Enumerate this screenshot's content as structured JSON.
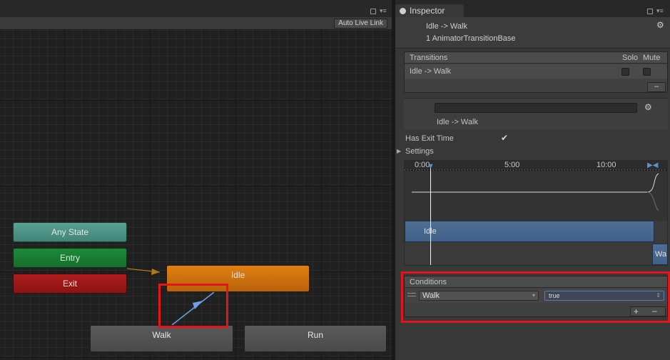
{
  "graph": {
    "toolbar": {
      "auto_live_link": "Auto Live Link"
    },
    "nodes": {
      "any_state": "Any State",
      "entry": "Entry",
      "exit": "Exit",
      "idle": "Idle",
      "walk": "Walk",
      "run": "Run"
    }
  },
  "inspector": {
    "tab_label": "Inspector",
    "header": {
      "title": "Idle -> Walk",
      "subtitle": "1 AnimatorTransitionBase"
    },
    "transitions": {
      "heading": "Transitions",
      "col_solo": "Solo",
      "col_mute": "Mute",
      "rows": [
        {
          "label": "Idle -> Walk",
          "solo": false,
          "mute": false
        }
      ],
      "remove_label": "–"
    },
    "name_section": {
      "name_value": "",
      "label": "Idle -> Walk"
    },
    "has_exit_time": {
      "label": "Has Exit Time",
      "checked": true
    },
    "settings": {
      "label": "Settings"
    },
    "timeline": {
      "ticks": [
        "0:00",
        "5:00",
        "10:00"
      ],
      "idle_clip": "Idle",
      "walk_clip": "Wa"
    },
    "conditions": {
      "heading": "Conditions",
      "parameter": "Walk",
      "value": "true",
      "add_label": "+",
      "remove_label": "–"
    }
  },
  "colors": {
    "highlight": "#e3151c",
    "idle_state": "#e08014",
    "entry_state": "#1d8a39",
    "exit_state": "#b01d1d",
    "any_state": "#5aa294",
    "transition_arrow": "#6e9fe0"
  }
}
